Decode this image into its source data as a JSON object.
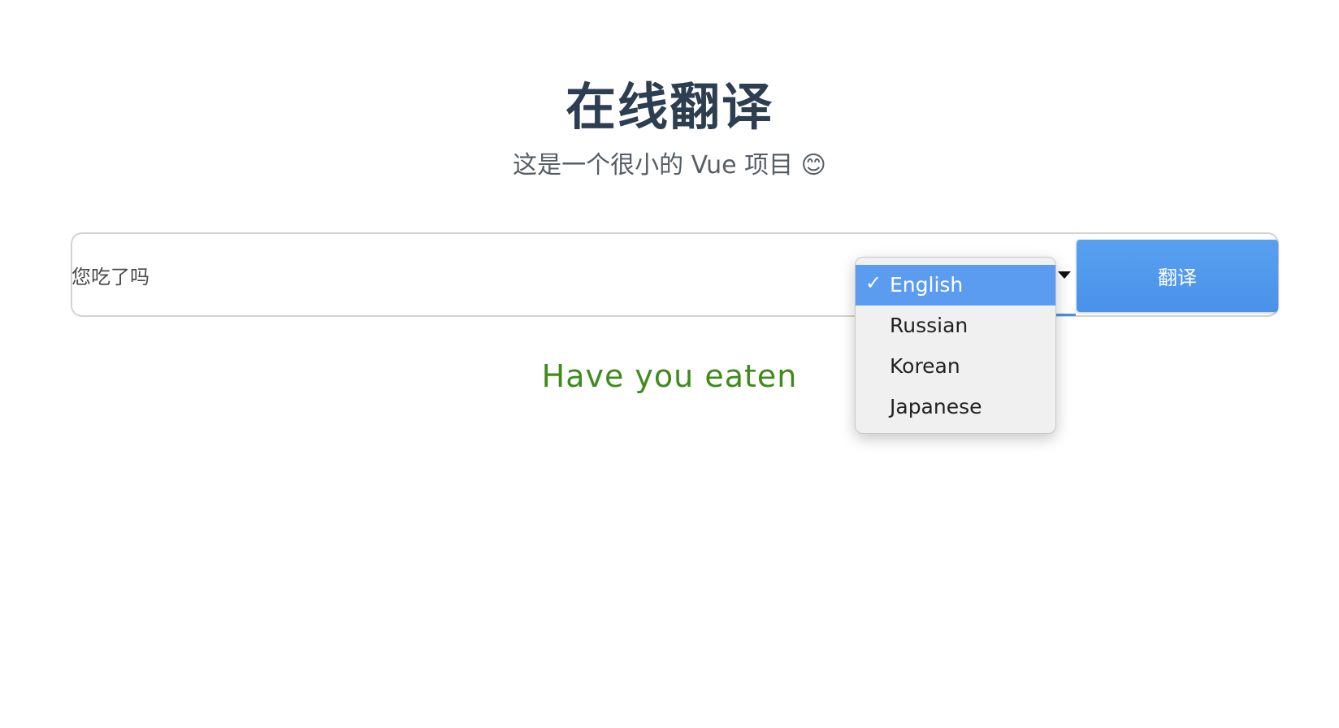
{
  "header": {
    "title": "在线翻译",
    "subtitle": "这是一个很小的 Vue 项目 😊"
  },
  "form": {
    "input_value": "您吃了吗",
    "button_label": "翻译",
    "language_select": {
      "selected": "English",
      "options": [
        "English",
        "Russian",
        "Korean",
        "Japanese"
      ]
    }
  },
  "result": {
    "text": "Have you eaten"
  },
  "colors": {
    "title": "#2c3e50",
    "button": "#4a92ea",
    "selected_option": "#5c9cf0",
    "result_text": "#3e8b1c"
  }
}
